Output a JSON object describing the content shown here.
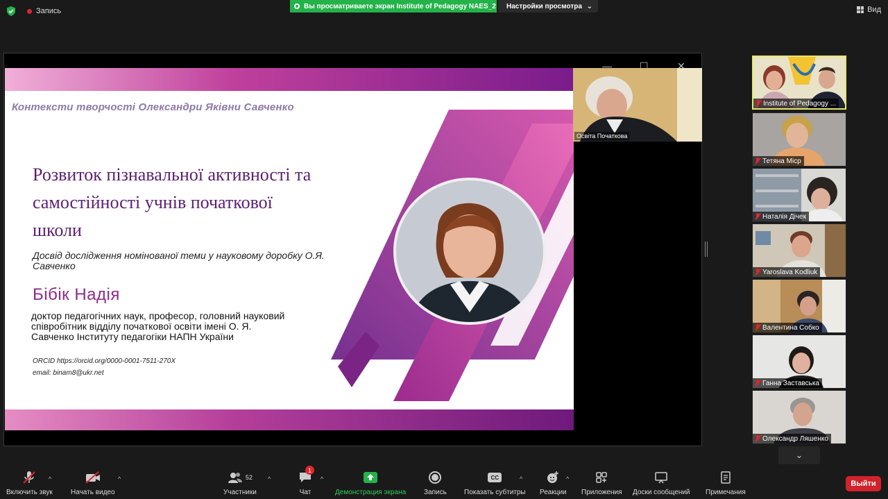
{
  "topbar": {
    "record_label": "Запись",
    "share_banner": "Вы просматриваете экран Institute of Pedagogy NAES_2",
    "view_options": "Настройки просмотра",
    "view_label": "Вид"
  },
  "slide": {
    "subtitle": "Контексти творчості Олександри Яківни Савченко",
    "title": "Розвиток пізнавальної активності та самостійності учнів початкової школи",
    "description": "Досвід дослідження номінованої теми у науковому доробку О.Я. Савченко",
    "author": "Бібік Надія",
    "bio": "доктор педагогічних наук, професор, головний науковий співробітник відділу початкової освіти імені О. Я. Савченко Інституту педагогіки НАПН України",
    "orcid": "ORCID https://orcid.org/0000-0001-7511-270X",
    "email": "email: binam8@ukr.net"
  },
  "speaker": {
    "name": "Освіта Початкова"
  },
  "participants": [
    {
      "name": "Institute of Pedagogy ...",
      "active": true
    },
    {
      "name": "Тетяна Міср"
    },
    {
      "name": "Наталія Дічек"
    },
    {
      "name": "Yaroslava Kodliuk"
    },
    {
      "name": "Валентина Собко"
    },
    {
      "name": "Ганна Заставська"
    },
    {
      "name": "Олександр Ляшенко"
    }
  ],
  "toolbar": {
    "audio": "Включить звук",
    "video": "Начать видео",
    "participants": "Участники",
    "participants_count": "52",
    "chat": "Чат",
    "chat_badge": "1",
    "share": "Демонстрация экрана",
    "record": "Запись",
    "captions": "Показать субтитры",
    "captions_icon_text": "CC",
    "reactions": "Реакции",
    "apps": "Приложения",
    "whiteboards": "Доски сообщений",
    "notes": "Примечания",
    "leave": "Выйти"
  },
  "colors": {
    "share_banner": "#24b24a",
    "leave": "#d0232c",
    "accent_magenta": "#c0409c",
    "accent_purple": "#6e1a7c",
    "active_tile_border": "#e7e76d"
  }
}
